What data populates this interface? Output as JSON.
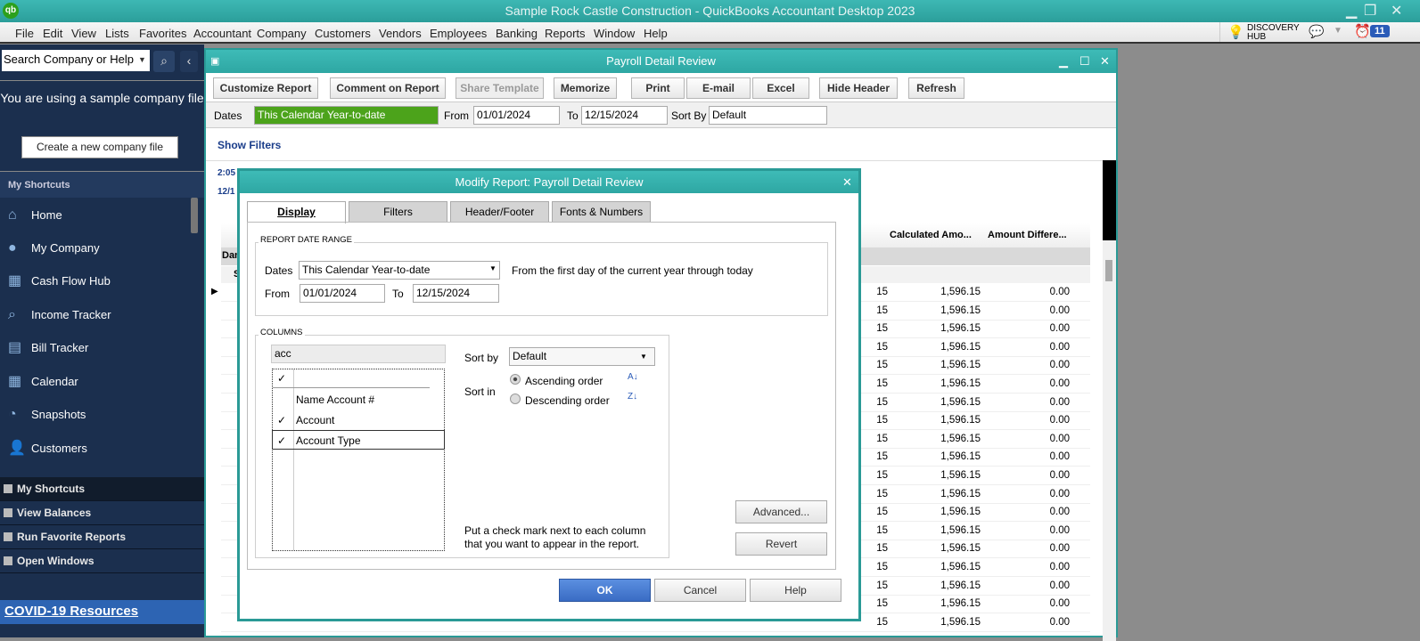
{
  "app": {
    "title": "Sample Rock Castle Construction  - QuickBooks Accountant Desktop 2023",
    "logo": "qb"
  },
  "menu": [
    "File",
    "Edit",
    "View",
    "Lists",
    "Favorites",
    "Accountant",
    "Company",
    "Customers",
    "Vendors",
    "Employees",
    "Banking",
    "Reports",
    "Window",
    "Help"
  ],
  "toolbar_right": {
    "discovery_line1": "DISCOVERY",
    "discovery_line2": "HUB",
    "reminders_count": "11"
  },
  "sidebar": {
    "search_placeholder": "Search Company or Help",
    "sample_notice": "You are using a sample company file",
    "create_button": "Create a new company file",
    "section_title": "My Shortcuts",
    "items": [
      {
        "label": "Home",
        "icon": "home-icon"
      },
      {
        "label": "My Company",
        "icon": "company-icon"
      },
      {
        "label": "Cash Flow Hub",
        "icon": "cash-flow-icon"
      },
      {
        "label": "Income Tracker",
        "icon": "income-tracker-icon"
      },
      {
        "label": "Bill Tracker",
        "icon": "bill-tracker-icon"
      },
      {
        "label": "Calendar",
        "icon": "calendar-icon"
      },
      {
        "label": "Snapshots",
        "icon": "snapshots-icon"
      },
      {
        "label": "Customers",
        "icon": "customers-icon"
      }
    ],
    "bottom": [
      "My Shortcuts",
      "View Balances",
      "Run Favorite Reports",
      "Open Windows"
    ],
    "covid_link": "COVID-19 Resources"
  },
  "report": {
    "title": "Payroll Detail Review",
    "buttons": [
      "Customize Report",
      "Comment on Report",
      "Share Template",
      "Memorize",
      "Print",
      "E-mail",
      "Excel",
      "Hide Header",
      "Refresh"
    ],
    "dates_label": "Dates",
    "dates_value": "This Calendar Year-to-date",
    "from_label": "From",
    "from_value": "01/01/2024",
    "to_label": "To",
    "to_value": "12/15/2024",
    "sort_label": "Sort By",
    "sort_value": "Default",
    "show_filters": "Show Filters",
    "time_partial": "2:05",
    "date_partial": "12/1",
    "col_headers": [
      "Calculated Amo...",
      "Amount Differe..."
    ],
    "group_partial": "Dan",
    "sub_partial": "S",
    "rows": [
      {
        "c0": "15",
        "c1": "1,596.15",
        "c2": "0.00"
      },
      {
        "c0": "15",
        "c1": "1,596.15",
        "c2": "0.00"
      },
      {
        "c0": "15",
        "c1": "1,596.15",
        "c2": "0.00"
      },
      {
        "c0": "15",
        "c1": "1,596.15",
        "c2": "0.00"
      },
      {
        "c0": "15",
        "c1": "1,596.15",
        "c2": "0.00"
      },
      {
        "c0": "15",
        "c1": "1,596.15",
        "c2": "0.00"
      },
      {
        "c0": "15",
        "c1": "1,596.15",
        "c2": "0.00"
      },
      {
        "c0": "15",
        "c1": "1,596.15",
        "c2": "0.00"
      },
      {
        "c0": "15",
        "c1": "1,596.15",
        "c2": "0.00"
      },
      {
        "c0": "15",
        "c1": "1,596.15",
        "c2": "0.00"
      },
      {
        "c0": "15",
        "c1": "1,596.15",
        "c2": "0.00"
      },
      {
        "c0": "15",
        "c1": "1,596.15",
        "c2": "0.00"
      },
      {
        "c0": "15",
        "c1": "1,596.15",
        "c2": "0.00"
      },
      {
        "c0": "15",
        "c1": "1,596.15",
        "c2": "0.00"
      },
      {
        "c0": "15",
        "c1": "1,596.15",
        "c2": "0.00"
      },
      {
        "c0": "15",
        "c1": "1,596.15",
        "c2": "0.00"
      },
      {
        "c0": "15",
        "c1": "1,596.15",
        "c2": "0.00"
      },
      {
        "c0": "15",
        "c1": "1,596.15",
        "c2": "0.00"
      },
      {
        "c0": "15",
        "c1": "1,596.15",
        "c2": "0.00"
      }
    ]
  },
  "dialog": {
    "title": "Modify Report: Payroll Detail Review",
    "tabs": [
      "Display",
      "Filters",
      "Header/Footer",
      "Fonts & Numbers"
    ],
    "range_title": "REPORT DATE RANGE",
    "dates_label": "Dates",
    "dates_value": "This Calendar Year-to-date",
    "dates_desc": "From the first day of the current year through today",
    "from_label": "From",
    "from_value": "01/01/2024",
    "to_label": "To",
    "to_value": "12/15/2024",
    "columns_title": "COLUMNS",
    "search_value": "acc",
    "check_header": "✓",
    "columns": [
      {
        "label": "Name Account #",
        "checked": ""
      },
      {
        "label": "Account",
        "checked": "✓"
      },
      {
        "label": "Account Type",
        "checked": "✓"
      }
    ],
    "sort_by_label": "Sort by",
    "sort_by_value": "Default",
    "sort_in_label": "Sort in",
    "ascending": "Ascending order",
    "descending": "Descending order",
    "hint": "Put a check mark next to each column that you want to appear in the report.",
    "advanced": "Advanced...",
    "revert": "Revert",
    "ok": "OK",
    "cancel": "Cancel",
    "help": "Help"
  }
}
